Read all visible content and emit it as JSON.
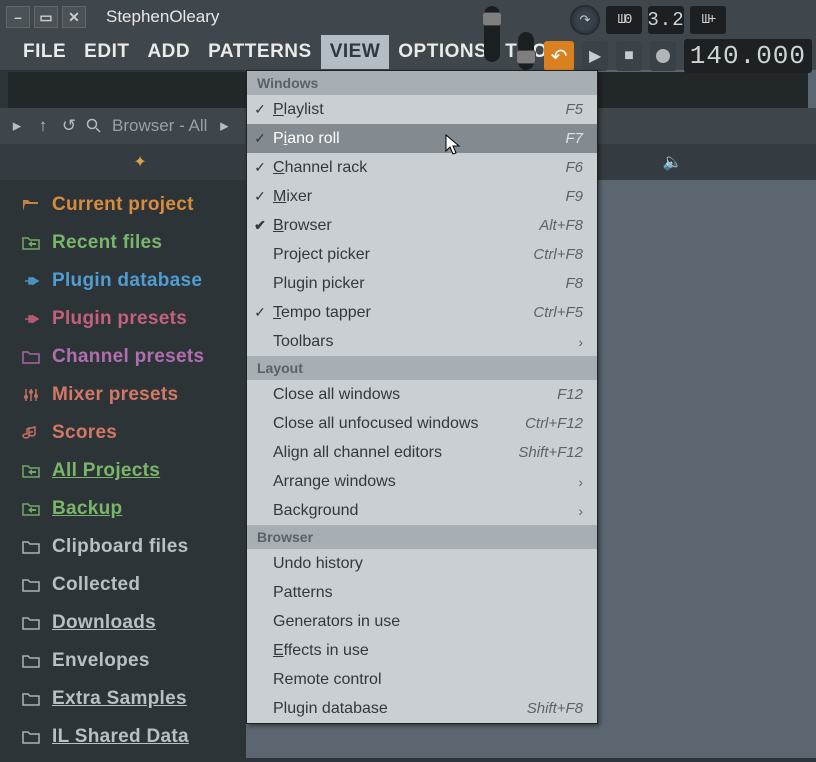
{
  "title": "StephenOleary",
  "menubar": {
    "file": "FILE",
    "edit": "EDIT",
    "add": "ADD",
    "patterns": "PATTERNS",
    "view": "VIEW",
    "options": "OPTIONS",
    "tools": "TOOLS",
    "help": "?"
  },
  "menubar_active": "VIEW",
  "browser": {
    "header": "Browser - All",
    "items": [
      {
        "label": "Current project",
        "color": "c-orange",
        "icon": "folder-open"
      },
      {
        "label": "Recent files",
        "color": "c-green",
        "icon": "folder-arrow"
      },
      {
        "label": "Plugin database",
        "color": "c-blue",
        "icon": "plug"
      },
      {
        "label": "Plugin presets",
        "color": "c-pink",
        "icon": "plug"
      },
      {
        "label": "Channel presets",
        "color": "c-purple",
        "icon": "folder"
      },
      {
        "label": "Mixer presets",
        "color": "c-red",
        "icon": "sliders"
      },
      {
        "label": "Scores",
        "color": "c-red",
        "icon": "note"
      },
      {
        "label": "All Projects",
        "color": "c-green",
        "icon": "folder-arrow",
        "underline": true
      },
      {
        "label": "Backup",
        "color": "c-green",
        "icon": "folder-arrow",
        "underline": true
      },
      {
        "label": "Clipboard files",
        "color": "c-grey",
        "icon": "folder"
      },
      {
        "label": "Collected",
        "color": "c-grey",
        "icon": "folder"
      },
      {
        "label": "Downloads",
        "color": "c-grey",
        "icon": "folder",
        "underline": true
      },
      {
        "label": "Envelopes",
        "color": "c-grey",
        "icon": "folder"
      },
      {
        "label": "Extra Samples",
        "color": "c-grey",
        "icon": "folder",
        "underline": true
      },
      {
        "label": "IL Shared Data",
        "color": "c-grey",
        "icon": "folder",
        "underline": true
      }
    ]
  },
  "transport": {
    "lcd1": "3.2",
    "bpm": "140.000"
  },
  "viewmenu": {
    "sections": [
      {
        "header": "Windows",
        "items": [
          {
            "label": "Playlist",
            "u": 0,
            "shortcut": "F5",
            "checked": true
          },
          {
            "label": "Piano roll",
            "u": 1,
            "shortcut": "F7",
            "checked": true,
            "highlight": true
          },
          {
            "label": "Channel rack",
            "u": 0,
            "shortcut": "F6",
            "checked": true
          },
          {
            "label": "Mixer",
            "u": 0,
            "shortcut": "F9",
            "checked": true
          },
          {
            "label": "Browser",
            "u": 0,
            "shortcut": "Alt+F8",
            "checked": true,
            "boldcheck": true
          },
          {
            "label": "Project picker",
            "shortcut": "Ctrl+F8"
          },
          {
            "label": "Plugin picker",
            "shortcut": "F8"
          },
          {
            "label": "Tempo tapper",
            "u": 0,
            "shortcut": "Ctrl+F5",
            "checked": true
          },
          {
            "label": "Toolbars",
            "submenu": true
          }
        ]
      },
      {
        "header": "Layout",
        "items": [
          {
            "label": "Close all windows",
            "shortcut": "F12"
          },
          {
            "label": "Close all unfocused windows",
            "shortcut": "Ctrl+F12"
          },
          {
            "label": "Align all channel editors",
            "shortcut": "Shift+F12"
          },
          {
            "label": "Arrange windows",
            "submenu": true
          },
          {
            "label": "Background",
            "submenu": true
          }
        ]
      },
      {
        "header": "Browser",
        "items": [
          {
            "label": "Undo history"
          },
          {
            "label": "Patterns"
          },
          {
            "label": "Generators in use"
          },
          {
            "label": "Effects in use",
            "u": 0
          },
          {
            "label": "Remote control"
          },
          {
            "label": "Plugin database",
            "shortcut": "Shift+F8"
          }
        ]
      }
    ]
  }
}
